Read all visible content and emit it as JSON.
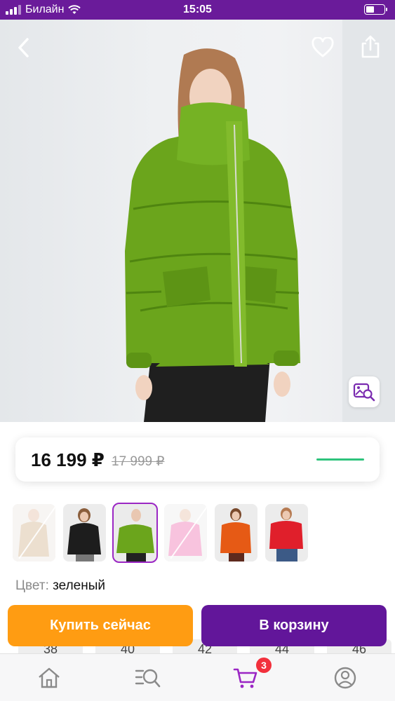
{
  "status_bar": {
    "carrier": "Билайн",
    "time": "15:05",
    "battery_level": 0.45
  },
  "product_image": {
    "alt": "green puffer jacket"
  },
  "price": {
    "current": "16 199 ₽",
    "old": "17 999 ₽",
    "accent": "#2ec37c"
  },
  "colors": {
    "label": "Цвет:",
    "selected": "зеленый",
    "thumbs": [
      {
        "color": "beige",
        "available": false
      },
      {
        "color": "black",
        "available": true
      },
      {
        "color": "green",
        "available": true,
        "selected": true
      },
      {
        "color": "pink",
        "available": false
      },
      {
        "color": "orange",
        "available": true
      },
      {
        "color": "red",
        "available": true
      }
    ]
  },
  "sizes": [
    "38",
    "40",
    "42",
    "44",
    "46"
  ],
  "actions": {
    "buy_now": "Купить сейчас",
    "add_to_cart": "В корзину"
  },
  "tabbar": {
    "cart_badge": "3"
  },
  "theme": {
    "brand": "#62169a",
    "buy": "#ff9c12",
    "badge": "#f2303c",
    "selected_outline": "#9b27c4"
  }
}
